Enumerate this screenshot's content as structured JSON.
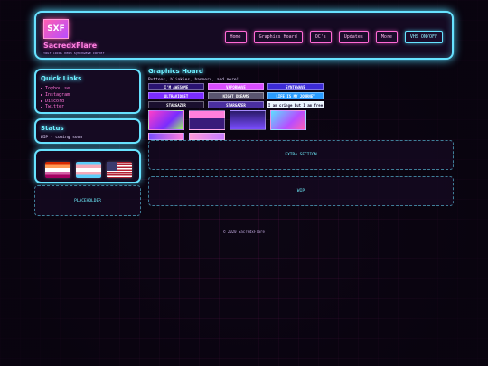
{
  "header": {
    "logo_text": "SXF",
    "site_name": "SacredxFlare",
    "tagline": "Your local neon synthwave corner",
    "nav": [
      "Home",
      "Graphics Hoard",
      "OC's",
      "Updates",
      "More"
    ],
    "vhs_toggle": "VHS ON/OFF"
  },
  "sidebar": {
    "quick_links_title": "Quick Links",
    "quick_links": [
      "Toyhou.se",
      "Instagram",
      "Discord",
      "Twitter"
    ],
    "status_title": "Status",
    "status_text": "WIP - coming soon",
    "flags": [
      "lesbian-flag",
      "trans-flag",
      "usa-flag"
    ],
    "placeholder": "PLACEHOLDER"
  },
  "main": {
    "title": "Graphics Hoard",
    "subtitle": "Buttons, blinkies, banners, and more!",
    "buttons": [
      {
        "label": "I'M AWESOME",
        "bg": "#2a1370"
      },
      {
        "label": "VAPORWAVE",
        "bg": "#d94dff"
      },
      {
        "label": "SYNTHWAVE",
        "bg": "#3c2bd6"
      },
      {
        "label": "ULTRAVIOLET",
        "bg": "#7b2cff"
      },
      {
        "label": "NIGHT DREAMS",
        "bg": "#5a5570"
      },
      {
        "label": "LIFE IS MY JOURNEY",
        "bg": "#2a9cff"
      },
      {
        "label": "STARGAZER",
        "bg": "#1a0f2e"
      },
      {
        "label": "STARGAZER",
        "bg": "#4a2fa0"
      },
      {
        "label": "I am cringe but I am free",
        "bg": "#e9f4ff"
      }
    ],
    "extra_section": "EXTRA SECTION",
    "wip": "WIP"
  },
  "footer": {
    "text": "© 2020 SacredxFlare"
  },
  "colors": {
    "accent_cyan": "#67e2ff",
    "accent_pink": "#ff6ad5",
    "background": "#0d0614"
  }
}
